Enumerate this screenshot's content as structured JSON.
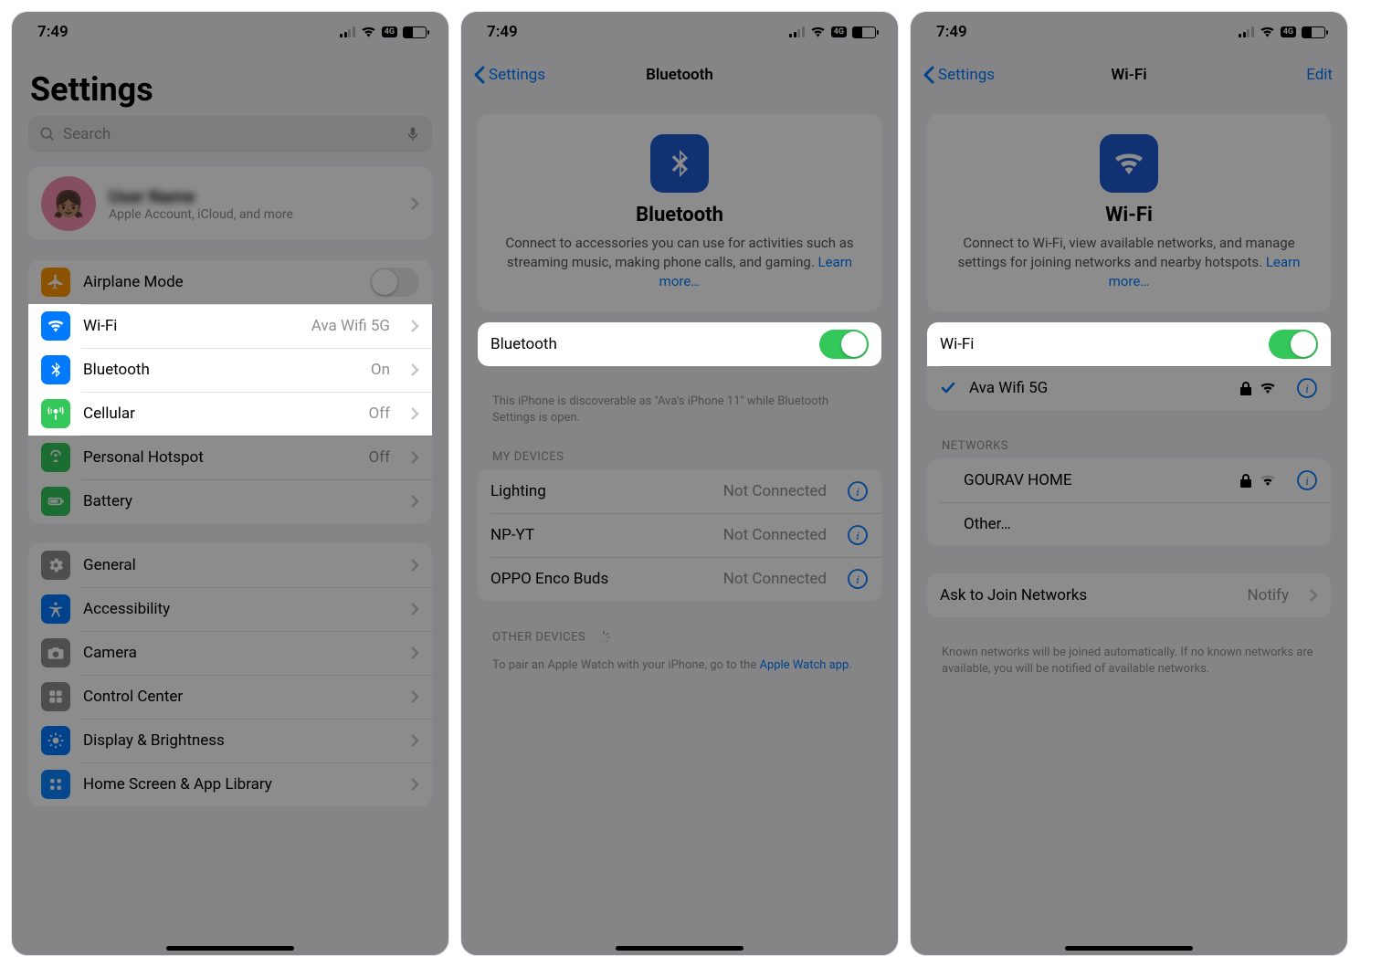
{
  "status": {
    "time": "7:49",
    "cell_badge": "4G"
  },
  "screen1": {
    "title": "Settings",
    "search_placeholder": "Search",
    "account": {
      "name": "User Name",
      "sub": "Apple Account, iCloud, and more"
    },
    "rows": {
      "airplane": "Airplane Mode",
      "wifi": "Wi-Fi",
      "wifi_value": "Ava Wifi 5G",
      "bluetooth": "Bluetooth",
      "bluetooth_value": "On",
      "cellular": "Cellular",
      "cellular_value": "Off",
      "hotspot": "Personal Hotspot",
      "hotspot_value": "Off",
      "battery": "Battery",
      "general": "General",
      "accessibility": "Accessibility",
      "camera": "Camera",
      "control_center": "Control Center",
      "display": "Display & Brightness",
      "home_screen": "Home Screen & App Library"
    }
  },
  "screen2": {
    "back": "Settings",
    "title": "Bluetooth",
    "hero_title": "Bluetooth",
    "hero_desc": "Connect to accessories you can use for activities such as streaming music, making phone calls, and gaming. ",
    "learn_more": "Learn more…",
    "toggle_label": "Bluetooth",
    "discoverable": "This iPhone is discoverable as \"Ava's iPhone 11\" while Bluetooth Settings is open.",
    "my_devices": "My Devices",
    "devices": [
      {
        "name": "Lighting",
        "status": "Not Connected"
      },
      {
        "name": "NP-YT",
        "status": "Not Connected"
      },
      {
        "name": "OPPO Enco Buds",
        "status": "Not Connected"
      }
    ],
    "other_devices": "Other Devices",
    "pair_note_pre": "To pair an Apple Watch with your iPhone, go to the ",
    "pair_note_link": "Apple Watch app",
    "pair_note_post": "."
  },
  "screen3": {
    "back": "Settings",
    "title": "Wi-Fi",
    "edit": "Edit",
    "hero_title": "Wi-Fi",
    "hero_desc": "Connect to Wi-Fi, view available networks, and manage settings for joining networks and nearby hotspots. ",
    "learn_more": "Learn more…",
    "toggle_label": "Wi-Fi",
    "connected": "Ava Wifi 5G",
    "networks_header": "Networks",
    "networks": [
      {
        "name": "GOURAV HOME"
      }
    ],
    "other": "Other…",
    "ask_join": "Ask to Join Networks",
    "ask_join_value": "Notify",
    "ask_join_note": "Known networks will be joined automatically. If no known networks are available, you will be notified of available networks."
  }
}
